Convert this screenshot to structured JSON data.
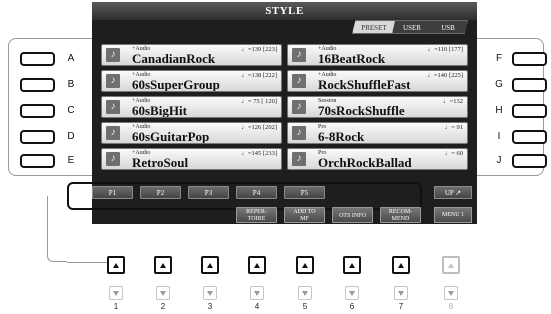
{
  "screen": {
    "title": "STYLE",
    "tabs": [
      {
        "label": "PRESET",
        "active": true
      },
      {
        "label": "USER",
        "active": false
      },
      {
        "label": "USB",
        "active": false
      }
    ]
  },
  "songs_left": [
    {
      "category": "+Audio",
      "name": "CanadianRock",
      "tempo": "♩=139 [223]"
    },
    {
      "category": "+Audio",
      "name": "60sSuperGroup",
      "tempo": "♩=138 [222]"
    },
    {
      "category": "+Audio",
      "name": "60sBigHit",
      "tempo": "♩= 75 [ 120]"
    },
    {
      "category": "+Audio",
      "name": "60sGuitarPop",
      "tempo": "♩=126 [202]"
    },
    {
      "category": "+Audio",
      "name": "RetroSoul",
      "tempo": "♩=145 [233]"
    }
  ],
  "songs_right": [
    {
      "category": "+Audio",
      "name": "16BeatRock",
      "tempo": "♩=110 [177]"
    },
    {
      "category": "+Audio",
      "name": "RockShuffleFast",
      "tempo": "♩=140 [225]"
    },
    {
      "category": "Session",
      "name": "70sRockShuffle",
      "tempo": "♩=132"
    },
    {
      "category": "Pro",
      "name": "6-8Rock",
      "tempo": "♩= 91"
    },
    {
      "category": "Pro",
      "name": "OrchRockBallad",
      "tempo": "♩= 60"
    }
  ],
  "left_buttons": [
    "A",
    "B",
    "C",
    "D",
    "E"
  ],
  "right_buttons": [
    "F",
    "G",
    "H",
    "I",
    "J"
  ],
  "pages": [
    "P1",
    "P2",
    "P3",
    "P4",
    "P5"
  ],
  "up_label": "UP ↗",
  "bottom_buttons": [
    {
      "line1": "REPER-",
      "line2": "TOIRE"
    },
    {
      "line1": "ADD TO",
      "line2": "MF"
    },
    {
      "line1": "OTS INFO",
      "line2": ""
    },
    {
      "line1": "RECOM-",
      "line2": "MEND"
    }
  ],
  "menu_label": "MENU 1",
  "number_buttons": [
    "1",
    "2",
    "3",
    "4",
    "5",
    "6",
    "7",
    "8"
  ]
}
